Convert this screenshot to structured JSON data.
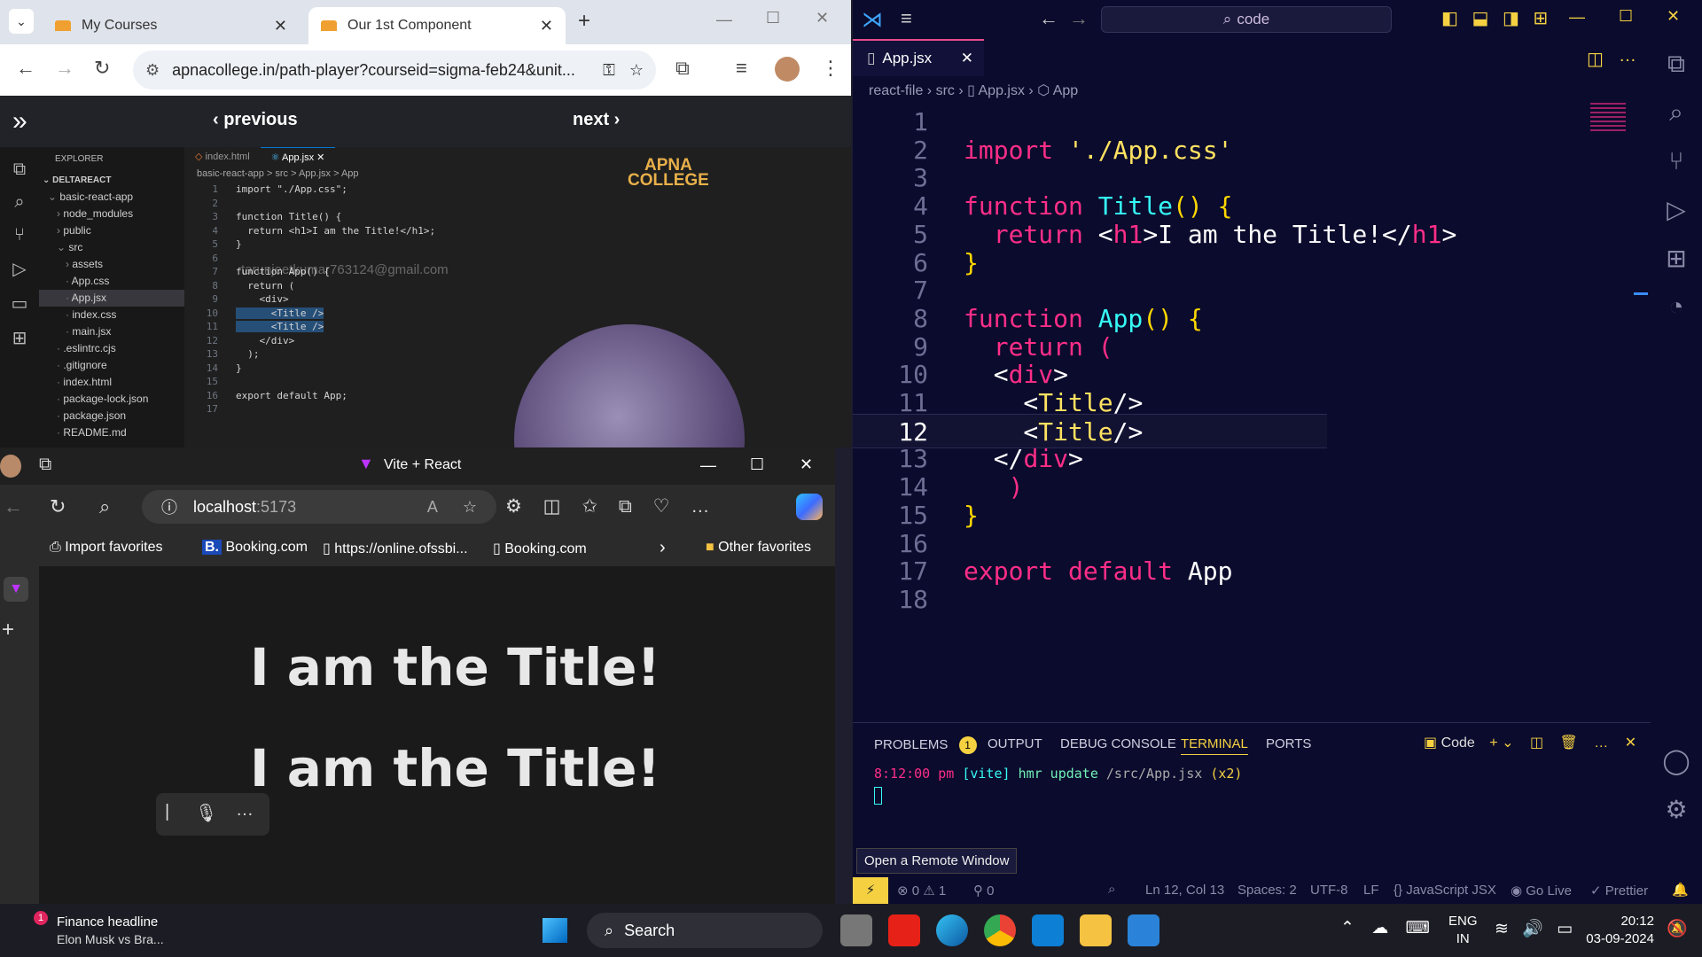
{
  "chrome": {
    "tabs": [
      {
        "title": "My Courses"
      },
      {
        "title": "Our 1st Component"
      }
    ],
    "url": "apnacollege.in/path-player?courseid=sigma-feb24&unit...",
    "course_nav": {
      "previous": "previous",
      "next": "next"
    },
    "watermark": "tarunjeetkumar763124@gmail.com",
    "logo": "APNA COLLEGE",
    "embedded_editor": {
      "explorer_title": "EXPLORER",
      "workspace": "DELTAREACT",
      "tree": [
        {
          "name": "basic-react-app",
          "depth": 0,
          "type": "folder-open"
        },
        {
          "name": "node_modules",
          "depth": 1,
          "type": "folder"
        },
        {
          "name": "public",
          "depth": 1,
          "type": "folder"
        },
        {
          "name": "src",
          "depth": 1,
          "type": "folder-open"
        },
        {
          "name": "assets",
          "depth": 2,
          "type": "folder"
        },
        {
          "name": "App.css",
          "depth": 2,
          "type": "file"
        },
        {
          "name": "App.jsx",
          "depth": 2,
          "type": "file",
          "active": true
        },
        {
          "name": "index.css",
          "depth": 2,
          "type": "file"
        },
        {
          "name": "main.jsx",
          "depth": 2,
          "type": "file"
        },
        {
          "name": ".eslintrc.cjs",
          "depth": 1,
          "type": "file"
        },
        {
          "name": ".gitignore",
          "depth": 1,
          "type": "file"
        },
        {
          "name": "index.html",
          "depth": 1,
          "type": "file"
        },
        {
          "name": "package-lock.json",
          "depth": 1,
          "type": "file"
        },
        {
          "name": "package.json",
          "depth": 1,
          "type": "file"
        },
        {
          "name": "README.md",
          "depth": 1,
          "type": "file"
        }
      ],
      "tabs": [
        "index.html",
        "App.jsx"
      ],
      "breadcrumb": "basic-react-app > src > App.jsx > App",
      "lines": [
        "import \"./App.css\";",
        "",
        "function Title() {",
        "  return <h1>I am the Title!</h1>;",
        "}",
        "",
        "function App() {",
        "  return (",
        "    <div>",
        "      <Title />",
        "      <Title />",
        "    </div>",
        "  );",
        "}",
        "",
        "export default App;",
        ""
      ]
    }
  },
  "edge": {
    "title": "Vite + React",
    "address_host": "localhost",
    "address_port": ":5173",
    "favorites": [
      "Import favorites",
      "Booking.com",
      "https://online.ofssbi...",
      "Booking.com",
      "Other favorites"
    ],
    "headings": [
      "I am the Title!",
      "I am the Title!"
    ]
  },
  "vscode": {
    "command_center": "code",
    "tab": "App.jsx",
    "breadcrumb": [
      "react-file",
      "src",
      "App.jsx",
      "App"
    ],
    "active_line": 12,
    "code_lines": [
      {
        "n": "1",
        "tokens": []
      },
      {
        "n": "2",
        "tokens": [
          [
            "kw",
            "import "
          ],
          [
            "str",
            "'./App.css'"
          ]
        ]
      },
      {
        "n": "3",
        "tokens": []
      },
      {
        "n": "4",
        "tokens": [
          [
            "kw",
            "function "
          ],
          [
            "fn",
            "Title"
          ],
          [
            "pun",
            "() {"
          ]
        ]
      },
      {
        "n": "5",
        "tokens": [
          [
            "txt",
            "  "
          ],
          [
            "kw",
            "return "
          ],
          [
            "txt",
            "<"
          ],
          [
            "tag",
            "h1"
          ],
          [
            "txt",
            ">I am the Title!</"
          ],
          [
            "tag",
            "h1"
          ],
          [
            "txt",
            ">"
          ]
        ]
      },
      {
        "n": "6",
        "tokens": [
          [
            "pun",
            "}"
          ]
        ]
      },
      {
        "n": "7",
        "tokens": []
      },
      {
        "n": "8",
        "tokens": [
          [
            "kw",
            "function "
          ],
          [
            "fn",
            "App"
          ],
          [
            "pun",
            "() {"
          ]
        ]
      },
      {
        "n": "9",
        "tokens": [
          [
            "txt",
            "  "
          ],
          [
            "kw",
            "return "
          ],
          [
            "kw",
            "("
          ]
        ]
      },
      {
        "n": "10",
        "tokens": [
          [
            "txt",
            "  <"
          ],
          [
            "tag",
            "div"
          ],
          [
            "txt",
            ">"
          ]
        ]
      },
      {
        "n": "11",
        "tokens": [
          [
            "txt",
            "    <"
          ],
          [
            "str",
            "Title"
          ],
          [
            "txt",
            "/>"
          ]
        ]
      },
      {
        "n": "12",
        "tokens": [
          [
            "txt",
            "    <"
          ],
          [
            "str",
            "Title"
          ],
          [
            "txt",
            "/>"
          ]
        ]
      },
      {
        "n": "13",
        "tokens": [
          [
            "txt",
            "  </"
          ],
          [
            "tag",
            "div"
          ],
          [
            "txt",
            ">"
          ]
        ]
      },
      {
        "n": "14",
        "tokens": [
          [
            "txt",
            "   "
          ],
          [
            "kw",
            ")"
          ]
        ]
      },
      {
        "n": "15",
        "tokens": [
          [
            "pun",
            "}"
          ]
        ]
      },
      {
        "n": "16",
        "tokens": []
      },
      {
        "n": "17",
        "tokens": [
          [
            "kw",
            "export default "
          ],
          [
            "txt",
            "App"
          ]
        ]
      },
      {
        "n": "18",
        "tokens": []
      }
    ],
    "panel_tabs": [
      "PROBLEMS",
      "OUTPUT",
      "DEBUG CONSOLE",
      "TERMINAL",
      "PORTS"
    ],
    "problems_count": "1",
    "terminal_name": "Code",
    "terminal_output": {
      "time": "8:12:00 pm",
      "tag": "[vite]",
      "msg": "hmr update",
      "path": "/src/App.jsx",
      "count": "(x2)"
    },
    "tooltip": "Open a Remote Window",
    "status": {
      "errors": "0",
      "warnings": "1",
      "ports": "0",
      "position": "Ln 12, Col 13",
      "spaces": "Spaces: 2",
      "encoding": "UTF-8",
      "eol": "LF",
      "language": "JavaScript JSX",
      "golive": "Go Live",
      "prettier": "Prettier"
    }
  },
  "taskbar": {
    "news_title": "Finance headline",
    "news_sub": "Elon Musk vs Bra...",
    "news_badge": "1",
    "search": "Search",
    "lang_top": "ENG",
    "lang_bottom": "IN",
    "time": "20:12",
    "date": "03-09-2024"
  },
  "colors": {
    "accent_pink": "#ff2e88",
    "accent_cyan": "#36f9f6",
    "accent_yellow": "#ffe261"
  }
}
